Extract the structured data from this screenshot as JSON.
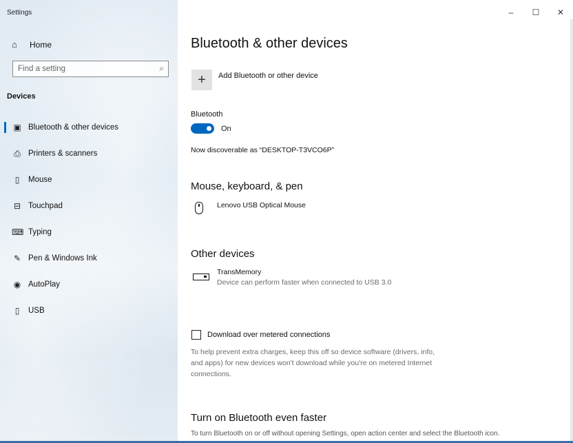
{
  "window": {
    "title": "Settings",
    "controls": {
      "minimize": "–",
      "maximize": "☐",
      "close": "✕"
    }
  },
  "sidebar": {
    "home_label": "Home",
    "search_placeholder": "Find a setting",
    "section": "Devices",
    "items": [
      {
        "label": "Bluetooth & other devices",
        "icon": "bluetooth-devices-icon",
        "selected": true
      },
      {
        "label": "Printers & scanners",
        "icon": "printer-icon"
      },
      {
        "label": "Mouse",
        "icon": "mouse-icon"
      },
      {
        "label": "Touchpad",
        "icon": "touchpad-icon"
      },
      {
        "label": "Typing",
        "icon": "keyboard-icon"
      },
      {
        "label": "Pen & Windows Ink",
        "icon": "pen-icon"
      },
      {
        "label": "AutoPlay",
        "icon": "autoplay-icon"
      },
      {
        "label": "USB",
        "icon": "usb-icon"
      }
    ]
  },
  "main": {
    "title": "Bluetooth & other devices",
    "add_device_label": "Add Bluetooth or other device",
    "bluetooth_label": "Bluetooth",
    "bluetooth_state": "On",
    "discoverable": "Now discoverable as “DESKTOP-T3VCO6P”",
    "mouse_section": "Mouse, keyboard, & pen",
    "mouse_device": "Lenovo USB Optical Mouse",
    "other_section": "Other devices",
    "other_device_name": "TransMemory",
    "other_device_status": "Device can perform faster when connected to USB 3.0",
    "metered_label": "Download over metered connections",
    "metered_help": "To help prevent extra charges, keep this off so device software (drivers, info, and apps) for new devices won't download while you're on metered Internet connections.",
    "faster_title": "Turn on Bluetooth even faster",
    "faster_text": "To turn Bluetooth on or off without opening Settings, open action center and select the Bluetooth icon."
  },
  "colors": {
    "accent": "#0067c0"
  }
}
